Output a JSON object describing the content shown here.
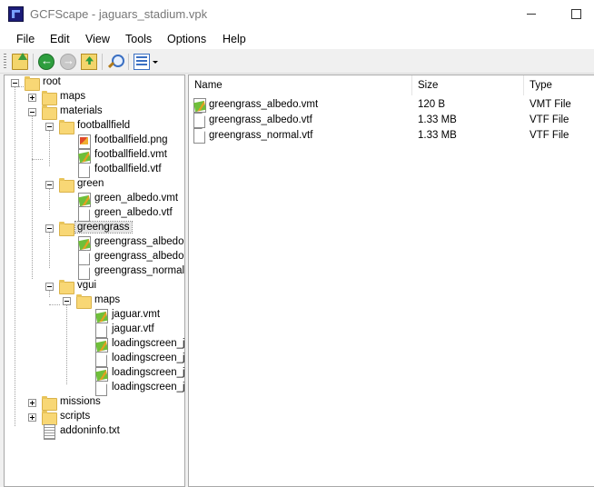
{
  "window": {
    "title": "GCFScape - jaguars_stadium.vpk"
  },
  "menu": {
    "items": [
      "File",
      "Edit",
      "View",
      "Tools",
      "Options",
      "Help"
    ]
  },
  "tree": {
    "root": "root",
    "maps": "maps",
    "materials": "materials",
    "footballfield": "footballfield",
    "footballfield_png": "footballfield.png",
    "footballfield_vmt": "footballfield.vmt",
    "footballfield_vtf": "footballfield.vtf",
    "green": "green",
    "green_albedo_vmt": "green_albedo.vmt",
    "green_albedo_vtf": "green_albedo.vtf",
    "greengrass": "greengrass",
    "greengrass_albedo_vmt": "greengrass_albedo.v",
    "greengrass_albedo_vtf": "greengrass_albedo.v",
    "greengrass_normal_vtf": "greengrass_normal.v",
    "vgui": "vgui",
    "vgui_maps": "maps",
    "jaguar_vmt": "jaguar.vmt",
    "jaguar_vtf": "jaguar.vtf",
    "loadingscreen_1": "loadingscreen_ja",
    "loadingscreen_2": "loadingscreen_ja",
    "loadingscreen_3": "loadingscreen_ja",
    "loadingscreen_4": "loadingscreen_ja",
    "missions": "missions",
    "scripts": "scripts",
    "addoninfo": "addoninfo.txt"
  },
  "list": {
    "columns": {
      "name": "Name",
      "size": "Size",
      "type": "Type"
    },
    "rows": [
      {
        "name": "greengrass_albedo.vmt",
        "size": "120 B",
        "type": "VMT File",
        "icon": "vmt-icon"
      },
      {
        "name": "greengrass_albedo.vtf",
        "size": "1.33 MB",
        "type": "VTF File",
        "icon": "file-icon"
      },
      {
        "name": "greengrass_normal.vtf",
        "size": "1.33 MB",
        "type": "VTF File",
        "icon": "file-icon"
      }
    ]
  }
}
